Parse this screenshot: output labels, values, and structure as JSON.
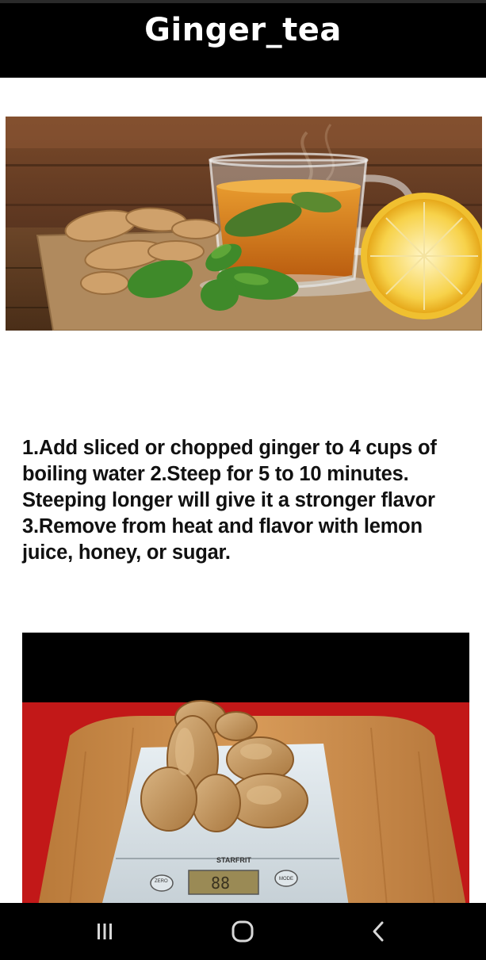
{
  "app_bar": {
    "title": "Ginger_tea"
  },
  "images": {
    "tea": {
      "alt": "ginger-tea-photo",
      "scale_brand": "STARFRIT",
      "scale_readout": "88",
      "zero_label": "ZERO",
      "mode_label": "MODE"
    }
  },
  "recipe": {
    "instructions": "1.Add sliced or chopped ginger to 4 cups of boiling water 2.Steep for 5 to 10 minutes. Steeping longer will give it a stronger flavor 3.Remove from heat and flavor with lemon juice, honey, or sugar."
  },
  "nav": {
    "recents_icon": "recents-icon",
    "home_icon": "home-icon",
    "back_icon": "back-icon"
  }
}
